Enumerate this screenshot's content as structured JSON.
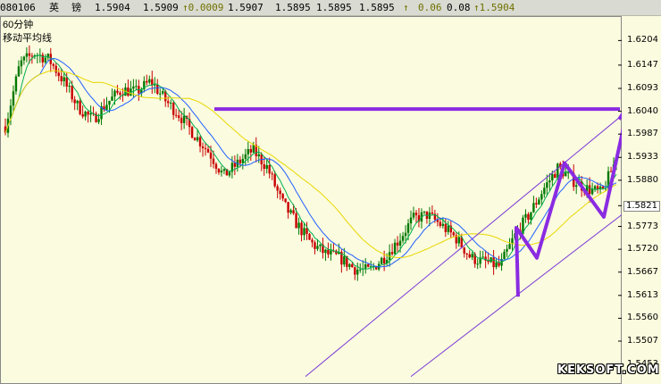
{
  "header": {
    "code": "080106",
    "name1": "英",
    "name2": "镑",
    "open": "1.5904",
    "high": "1.5909",
    "change": "↑0.0009",
    "close": "1.5907",
    "low1": "1.5895",
    "low2": "1.5895",
    "last": "1.5895",
    "arrow": "↑",
    "v1": "0.06",
    "v2": "0.08",
    "v3": "↑1.5904"
  },
  "chart_labels": {
    "period": "60分钟",
    "indicator": "移动平均线"
  },
  "watermark": "KEKSOFT.COM",
  "colors": {
    "background": "#fbfbdf",
    "up_candle": "#007800",
    "down_candle": "#c80000",
    "ma_green": "#00b050",
    "ma_blue": "#2060ff",
    "ma_yellow": "#e8d800",
    "annotation_purple": "#8a2be2",
    "channel_line": "#7a3ad8"
  },
  "chart_data": {
    "type": "candlestick",
    "title": "",
    "y_axis_ticks": [
      "1.6204",
      "1.6147",
      "1.6093",
      "1.6040",
      "1.5987",
      "1.5933",
      "1.5880",
      "1.5821",
      "1.5773",
      "1.5720",
      "1.5667",
      "1.5613",
      "1.5560",
      "1.5507",
      "1.5453"
    ],
    "y_highlight_tick": "1.5821",
    "ylim": [
      1.542,
      1.624
    ],
    "resistance_level": 1.6045,
    "price_path": [
      1.6005,
      1.615,
      1.6175,
      1.616,
      1.611,
      1.605,
      1.602,
      1.606,
      1.609,
      1.6085,
      1.611,
      1.6065,
      1.603,
      1.5985,
      1.5945,
      1.589,
      1.592,
      1.595,
      1.591,
      1.583,
      1.578,
      1.5735,
      1.571,
      1.57,
      1.5675,
      1.567,
      1.57,
      1.574,
      1.579,
      1.58,
      1.5775,
      1.5745,
      1.57,
      1.569,
      1.568,
      1.575,
      1.58,
      1.586,
      1.591,
      1.588,
      1.586,
      1.585,
      1.593
    ],
    "zigzag": [
      {
        "x": 0.0,
        "y": 1.561
      },
      {
        "x": 0.6,
        "y": 1.577
      },
      {
        "x": 1.0,
        "y": 1.57
      }
    ],
    "wave_points": [
      1.561,
      1.577,
      1.57,
      1.592,
      1.5795,
      1.604
    ],
    "channel": {
      "upper": [
        [
          1.5425,
          0.0
        ],
        [
          1.603,
          1.0
        ]
      ],
      "lower": [
        [
          1.5425,
          0.0
        ],
        [
          1.58,
          1.0
        ]
      ]
    }
  }
}
